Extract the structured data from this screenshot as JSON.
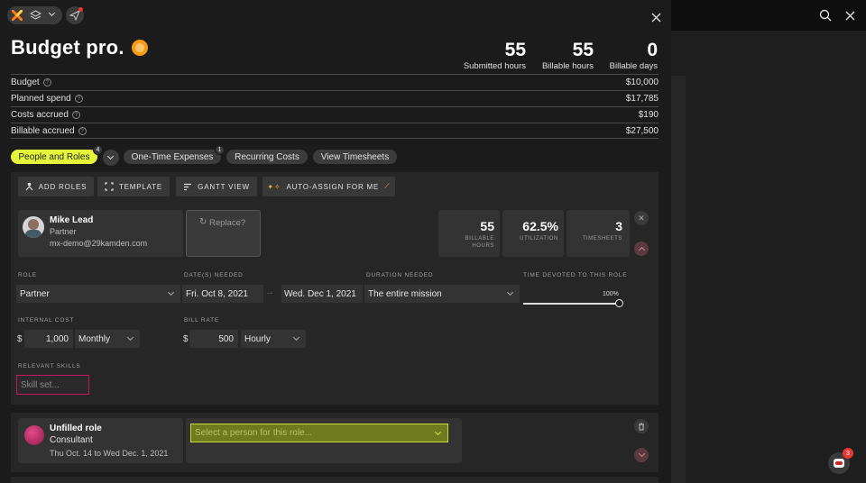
{
  "header": {
    "title": "Budget pro."
  },
  "stats": [
    {
      "value": "55",
      "label": "Submitted hours"
    },
    {
      "value": "55",
      "label": "Billable hours"
    },
    {
      "value": "0",
      "label": "Billable days"
    }
  ],
  "budget_rows": [
    {
      "label": "Budget",
      "value": "$10,000"
    },
    {
      "label": "Planned spend",
      "value": "$17,785"
    },
    {
      "label": "Costs accrued",
      "value": "$190"
    },
    {
      "label": "Billable accrued",
      "value": "$27,500"
    }
  ],
  "tabs": [
    {
      "label": "People and Roles",
      "badge": "4"
    },
    {
      "label": "One-Time Expenses",
      "badge": "1"
    },
    {
      "label": "Recurring Costs"
    },
    {
      "label": "View Timesheets"
    }
  ],
  "actions": {
    "add_roles": "ADD ROLES",
    "template": "TEMPLATE",
    "gantt": "GANTT VIEW",
    "auto_assign": "AUTO-ASSIGN FOR ME"
  },
  "person": {
    "name": "Mike Lead",
    "role": "Partner",
    "email": "mx-demo@29kamden.com",
    "replace": "Replace?",
    "billable_hours": "55",
    "billable_hours_label": "BILLABLE HOURS",
    "utilization": "62.5%",
    "utilization_label": "UTILIZATION",
    "timesheets": "3",
    "timesheets_label": "TIMESHEETS"
  },
  "form": {
    "role_label": "ROLE",
    "role_value": "Partner",
    "dates_label": "DATE(S) NEEDED",
    "date_start": "Fri. Oct 8, 2021",
    "date_end": "Wed. Dec 1, 2021",
    "duration_label": "DURATION NEEDED",
    "duration_value": "The entire mission",
    "time_label": "TIME DEVOTED TO THIS ROLE",
    "time_value": "100%",
    "time_fraction": 1.0,
    "internal_cost_label": "INTERNAL COST",
    "currency": "$",
    "internal_cost": "1,000",
    "internal_period": "Monthly",
    "bill_rate_label": "BILL RATE",
    "bill_rate": "500",
    "bill_period": "Hourly",
    "skills_label": "RELEVANT SKILLS",
    "skills_placeholder": "Skill set..."
  },
  "unfilled": {
    "title": "Unfilled role",
    "role": "Consultant",
    "dates": "Thu Oct. 14 to Wed Dec. 1, 2021",
    "select_placeholder": "Select a person for this role..."
  },
  "chat": {
    "badge": "3"
  },
  "colors": {
    "accent": "#e4f53a",
    "panel": "#262626",
    "card": "#333333",
    "danger": "#c2185b",
    "notif": "#e53935"
  }
}
